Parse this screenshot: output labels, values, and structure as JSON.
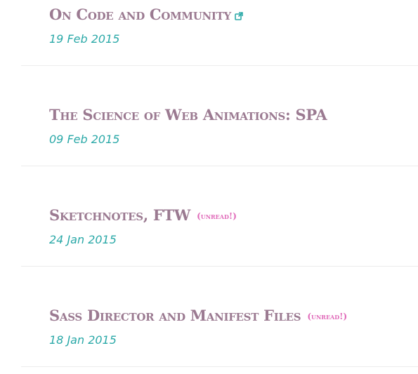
{
  "posts": [
    {
      "title": "On Code and Community",
      "date": "19 Feb 2015",
      "external_icon": "external-link-icon",
      "unread_label": ""
    },
    {
      "title": "The Science of Web Animations: SPA",
      "date": "09 Feb 2015",
      "external_icon": "",
      "unread_label": ""
    },
    {
      "title": "Sketchnotes, FTW",
      "date": "24 Jan 2015",
      "external_icon": "",
      "unread_label": "(unread!)"
    },
    {
      "title": "Sass Director and Manifest Files",
      "date": "18 Jan 2015",
      "external_icon": "",
      "unread_label": "(unread!)"
    }
  ],
  "colors": {
    "title": "#9b7a91",
    "date": "#2ba9a8",
    "unread": "#e06ab9",
    "divider": "#ececec"
  }
}
